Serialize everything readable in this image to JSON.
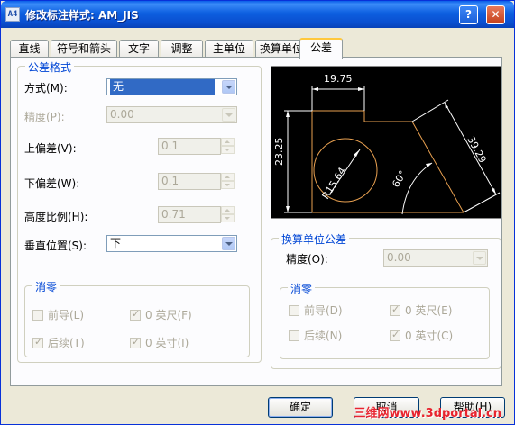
{
  "window": {
    "title": "修改标注样式: AM_JIS",
    "app_icon_text": "A4"
  },
  "tabs": [
    {
      "label": "直线"
    },
    {
      "label": "符号和箭头"
    },
    {
      "label": "文字"
    },
    {
      "label": "调整"
    },
    {
      "label": "主单位"
    },
    {
      "label": "换算单位"
    },
    {
      "label": "公差"
    }
  ],
  "active_tab": "公差",
  "tolerance_format": {
    "title": "公差格式",
    "method": {
      "label": "方式(M):",
      "value": "无"
    },
    "precision": {
      "label": "精度(P):",
      "value": "0.00"
    },
    "upper": {
      "label": "上偏差(V):",
      "value": "0.1"
    },
    "lower": {
      "label": "下偏差(W):",
      "value": "0.1"
    },
    "height_scale": {
      "label": "高度比例(H):",
      "value": "0.71"
    },
    "vertical_position": {
      "label": "垂直位置(S):",
      "value": "下"
    }
  },
  "zero_suppress_left": {
    "title": "消零",
    "leading": {
      "label": "前导(L)",
      "checked": false
    },
    "feet": {
      "label": "0 英尺(F)",
      "checked": true
    },
    "trailing": {
      "label": "后续(T)",
      "checked": true
    },
    "inches": {
      "label": "0 英寸(I)",
      "checked": true
    }
  },
  "alt_unit_tolerance": {
    "title": "换算单位公差",
    "precision": {
      "label": "精度(O):",
      "value": "0.00"
    }
  },
  "zero_suppress_right": {
    "title": "消零",
    "leading": {
      "label": "前导(D)",
      "checked": false
    },
    "feet": {
      "label": "0 英尺(E)",
      "checked": true
    },
    "trailing": {
      "label": "后续(N)",
      "checked": false
    },
    "inches": {
      "label": "0 英寸(C)",
      "checked": true
    }
  },
  "preview": {
    "dim_top": "19.75",
    "dim_left": "23.25",
    "dim_right": "39.29",
    "dim_radius": "R15.64",
    "dim_angle": "60°"
  },
  "buttons": {
    "ok": "确定",
    "cancel": "取消",
    "help": "帮助(H)"
  },
  "watermark": "三维网www.3dportal.cn"
}
